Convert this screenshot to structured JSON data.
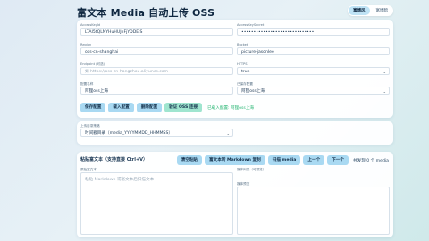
{
  "header": {
    "title": "富文本 Media 自动上传 OSS",
    "modes": [
      "富博风",
      "富博暗"
    ]
  },
  "config": {
    "access_key_id": {
      "label": "AccessKeyId",
      "value": "LTAI5tQLNYHuHUJnFjYDDEIS"
    },
    "access_key_secret": {
      "label": "AccessKeySecret",
      "value": "••••••••••••••••••••••••••••••"
    },
    "region": {
      "label": "Region",
      "value": "oss-cn-shanghai"
    },
    "bucket": {
      "label": "Bucket",
      "value": "picture-jasonlee"
    },
    "endpoint": {
      "label": "Endpoint (可选)",
      "placeholder": "如 https://oss-cn-hangzhou.aliyuncs.com"
    },
    "https": {
      "label": "HTTPS",
      "value": "true"
    },
    "config_name": {
      "label": "配置名称",
      "value": "阿狸oss上海"
    },
    "saved_config": {
      "label": "已保存配置",
      "value": "阿狸oss上海"
    },
    "buttons": [
      "保存配置",
      "载入配置",
      "删除配置",
      "验证 OSS 连接"
    ],
    "status": "已载入配置: 阿狸oss上海"
  },
  "upload": {
    "label": "上传目录策略",
    "value": "时间戳目录（media_YYYYMMDD_HHMMSS）"
  },
  "paste": {
    "heading": "粘贴富文本（支持直接 Ctrl+V）",
    "tools": [
      "清空粘贴",
      "富文本转 Markdown 复制",
      "扫描 media",
      "上一个",
      "下一个"
    ],
    "count": "共发现 0 个 media",
    "editor_label": "原始富文本",
    "editor_placeholder": "粘贴 Markdown 或富文本后扫描文本",
    "preview_label1": "媒体列表（可预览）",
    "preview_label2": "媒体预览"
  },
  "colors": {
    "accent": "#a9d9f2",
    "success": "#27b673",
    "verify": "#9fe5cf"
  }
}
